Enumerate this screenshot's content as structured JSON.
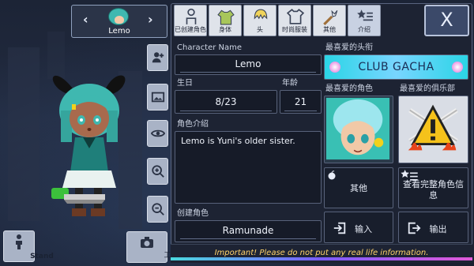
{
  "character_switcher": {
    "name": "Lemo",
    "prev": "‹",
    "next": "›"
  },
  "left_buttons": {
    "stand_label": "Stand",
    "studio_label": "工作室"
  },
  "tabs": [
    {
      "label": "已创建角色",
      "icon": "person-outline-icon"
    },
    {
      "label": "身体",
      "icon": "shirt-body-icon"
    },
    {
      "label": "头",
      "icon": "hair-head-icon"
    },
    {
      "label": "时尚服装",
      "icon": "tshirt-icon"
    },
    {
      "label": "其他",
      "icon": "sword-cat-icon"
    },
    {
      "label": "介绍",
      "icon": "star-list-icon"
    }
  ],
  "close_label": "X",
  "profile": {
    "name_label": "Character Name",
    "name_value": "Lemo",
    "birthday_label": "生日",
    "birthday_value": "8/23",
    "age_label": "年龄",
    "age_value": "21",
    "intro_label": "角色介绍",
    "intro_value": "Lemo is Yuni's older sister.",
    "creator_label": "创建角色",
    "creator_value": "Ramunade"
  },
  "favorites": {
    "title_label": "最喜爱的头衔",
    "title_value": "CLUB GACHA",
    "character_label": "最喜爱的角色",
    "club_label": "最喜爱的俱乐部"
  },
  "actions": {
    "other_label": "其他",
    "view_info_label": "查看完整角色信息",
    "import_label": "输入",
    "export_label": "输出"
  },
  "warning_text": "Important! Please do not put any real life information.",
  "colors": {
    "accent": "#3fb8b0",
    "warning": "#ffd36b",
    "panel": "#1d2333"
  }
}
